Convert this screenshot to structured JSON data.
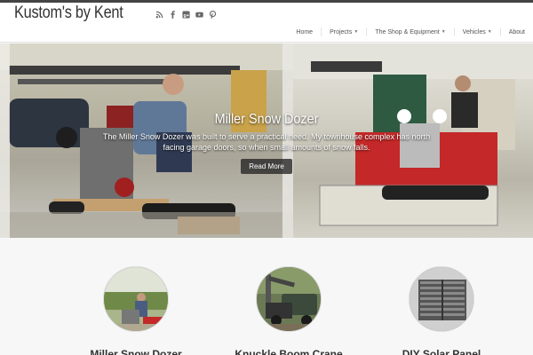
{
  "site": {
    "title": "Kustom's by Kent"
  },
  "social": [
    {
      "icon": "rss-icon"
    },
    {
      "icon": "facebook-icon"
    },
    {
      "icon": "google-plus-icon"
    },
    {
      "icon": "youtube-icon"
    },
    {
      "icon": "pinterest-icon"
    }
  ],
  "nav": {
    "home": "Home",
    "projects": "Projects",
    "shop": "The Shop & Equipment",
    "vehicles": "Vehicles",
    "about": "About"
  },
  "slider": {
    "title": "Miller Snow Dozer",
    "text": "The Miller Snow Dozer was built to serve a practical need. My townhouse complex has north facing garage doors, so when small amounts of snow falls.",
    "button": "Read More"
  },
  "featured": [
    {
      "label": "Miller Snow Dozer"
    },
    {
      "label": "Knuckle Boom Crane"
    },
    {
      "label": "DIY Solar Panel"
    }
  ],
  "colors": {
    "accent_red": "#c8241c",
    "topbar": "#444444",
    "text": "#333333"
  }
}
